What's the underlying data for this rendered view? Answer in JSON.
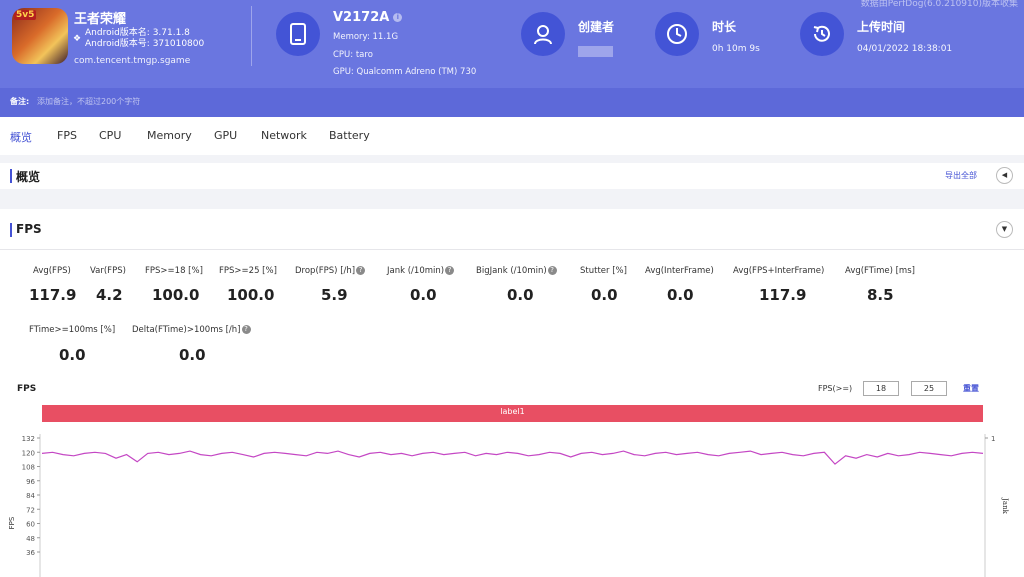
{
  "watermark": "数据由PerfDog(6.0.210910)版本收集",
  "app": {
    "name": "王者荣耀",
    "icon_badge": "5v5",
    "android_version": "Android版本名: 3.71.1.8",
    "android_code": "Android版本号: 371010800",
    "package": "com.tencent.tmgp.sgame"
  },
  "device": {
    "name": "V2172A",
    "memory": "Memory: 11.1G",
    "cpu": "CPU: taro",
    "gpu": "GPU: Qualcomm Adreno (TM) 730"
  },
  "meta": {
    "creator_label": "创建者",
    "duration_label": "时长",
    "duration_value": "0h 10m 9s",
    "upload_label": "上传时间",
    "upload_value": "04/01/2022 18:38:01"
  },
  "note": {
    "label": "备注:",
    "placeholder": "添加备注，不超过200个字符"
  },
  "tabs": [
    "概览",
    "FPS",
    "CPU",
    "Memory",
    "GPU",
    "Network",
    "Battery"
  ],
  "overview": {
    "title": "概览",
    "export": "导出全部"
  },
  "fps_section": {
    "title": "FPS",
    "stats_row1": [
      {
        "label": "Avg(FPS)",
        "value": "117.9"
      },
      {
        "label": "Var(FPS)",
        "value": "4.2"
      },
      {
        "label": "FPS>=18 [%]",
        "value": "100.0"
      },
      {
        "label": "FPS>=25 [%]",
        "value": "100.0"
      },
      {
        "label": "Drop(FPS) [/h]",
        "value": "5.9"
      },
      {
        "label": "Jank (/10min)",
        "value": "0.0"
      },
      {
        "label": "BigJank (/10min)",
        "value": "0.0"
      },
      {
        "label": "Stutter [%]",
        "value": "0.0"
      },
      {
        "label": "Avg(InterFrame)",
        "value": "0.0"
      },
      {
        "label": "Avg(FPS+InterFrame)",
        "value": "117.9"
      },
      {
        "label": "Avg(FTime) [ms]",
        "value": "8.5"
      }
    ],
    "stats_row2": [
      {
        "label": "FTime>=100ms [%]",
        "value": "0.0"
      },
      {
        "label": "Delta(FTime)>100ms [/h]",
        "value": "0.0"
      }
    ]
  },
  "chart": {
    "title": "FPS",
    "filter_label": "FPS(>=)",
    "filter_low": "18",
    "filter_high": "25",
    "reset": "重置",
    "label_bar": "label1",
    "bar_color": "#e84f63",
    "line_color": "#c447c4",
    "y_axis_label": "FPS",
    "right_axis_label": "Jank"
  },
  "chart_data": {
    "type": "line",
    "title": "",
    "ylabel": "FPS",
    "y_ticks": [
      132,
      120,
      108,
      96,
      84,
      72,
      60,
      48,
      36
    ],
    "right_ticks": [
      1
    ],
    "ylim": [
      36,
      132
    ],
    "series": [
      {
        "name": "",
        "values": [
          119,
          120,
          118,
          117,
          119,
          120,
          119,
          115,
          118,
          112,
          119,
          120,
          118,
          119,
          121,
          118,
          117,
          119,
          120,
          118,
          116,
          119,
          120,
          119,
          118,
          117,
          120,
          119,
          121,
          118,
          116,
          119,
          120,
          118,
          119,
          117,
          119,
          120,
          118,
          119,
          120,
          117,
          119,
          118,
          120,
          119,
          117,
          118,
          120,
          119,
          116,
          119,
          120,
          118,
          119,
          121,
          118,
          117,
          119,
          120,
          118,
          119,
          120,
          118,
          117,
          119,
          120,
          121,
          118,
          119,
          120,
          118,
          117,
          119,
          120,
          110,
          117,
          115,
          118,
          116,
          119,
          117,
          118,
          120,
          119,
          118,
          117,
          119,
          120,
          119
        ]
      }
    ]
  }
}
